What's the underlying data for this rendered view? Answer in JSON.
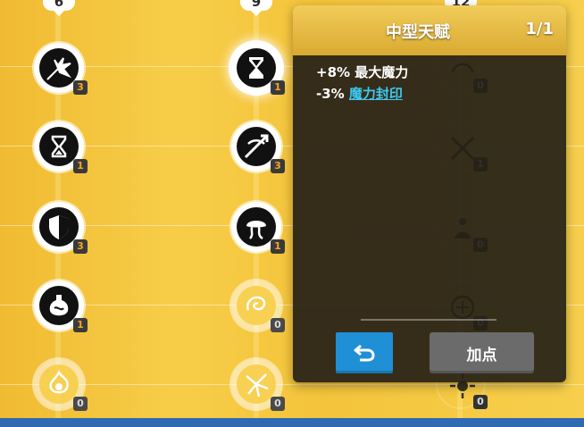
{
  "tiers": [
    {
      "label": "6"
    },
    {
      "label": "9"
    },
    {
      "label": "12"
    }
  ],
  "tree": {
    "column1": [
      {
        "icon": "explosion-arrow-icon",
        "count": "3",
        "state": "unlocked"
      },
      {
        "icon": "hourglass-icon",
        "count": "1",
        "state": "unlocked"
      },
      {
        "icon": "shield-icon",
        "count": "3",
        "state": "unlocked"
      },
      {
        "icon": "potion-flask-icon",
        "count": "1",
        "state": "unlocked"
      },
      {
        "icon": "flame-burst-icon",
        "count": "0",
        "state": "locked"
      }
    ],
    "column2": [
      {
        "icon": "hourglass-icon",
        "count": "1",
        "state": "selected"
      },
      {
        "icon": "piercing-arrow-icon",
        "count": "3",
        "state": "unlocked"
      },
      {
        "icon": "mushroom-cloud-icon",
        "count": "1",
        "state": "unlocked"
      },
      {
        "icon": "swirl-creature-icon",
        "count": "0",
        "state": "locked"
      },
      {
        "icon": "shatter-icon",
        "count": "0",
        "state": "locked"
      }
    ],
    "column3": [
      {
        "icon": "arc-icon",
        "count": "0"
      },
      {
        "icon": "crossed-arrows-icon",
        "count": "1"
      },
      {
        "icon": "meditation-icon",
        "count": "0"
      },
      {
        "icon": "rune-circle-icon",
        "count": "0"
      },
      {
        "icon": "burst-icon",
        "count": "0"
      }
    ]
  },
  "popup": {
    "title": "中型天赋",
    "level": "1/1",
    "effects": [
      {
        "prefix": "+8% 最大魔力",
        "link": ""
      },
      {
        "prefix": "-3% ",
        "link": "魔力封印"
      }
    ],
    "undo_label": "undo-arrow-icon",
    "add_point_label": "加点"
  },
  "colors": {
    "background": "#f4c43b",
    "popup_header": "#e2b43e",
    "popup_body": "#262117",
    "link": "#3ec9f3",
    "undo_button": "#1f8fd6",
    "add_point_button": "#6b6b6b",
    "count_text": "#f5a623",
    "bottom_strip": "#2f6ab3"
  }
}
